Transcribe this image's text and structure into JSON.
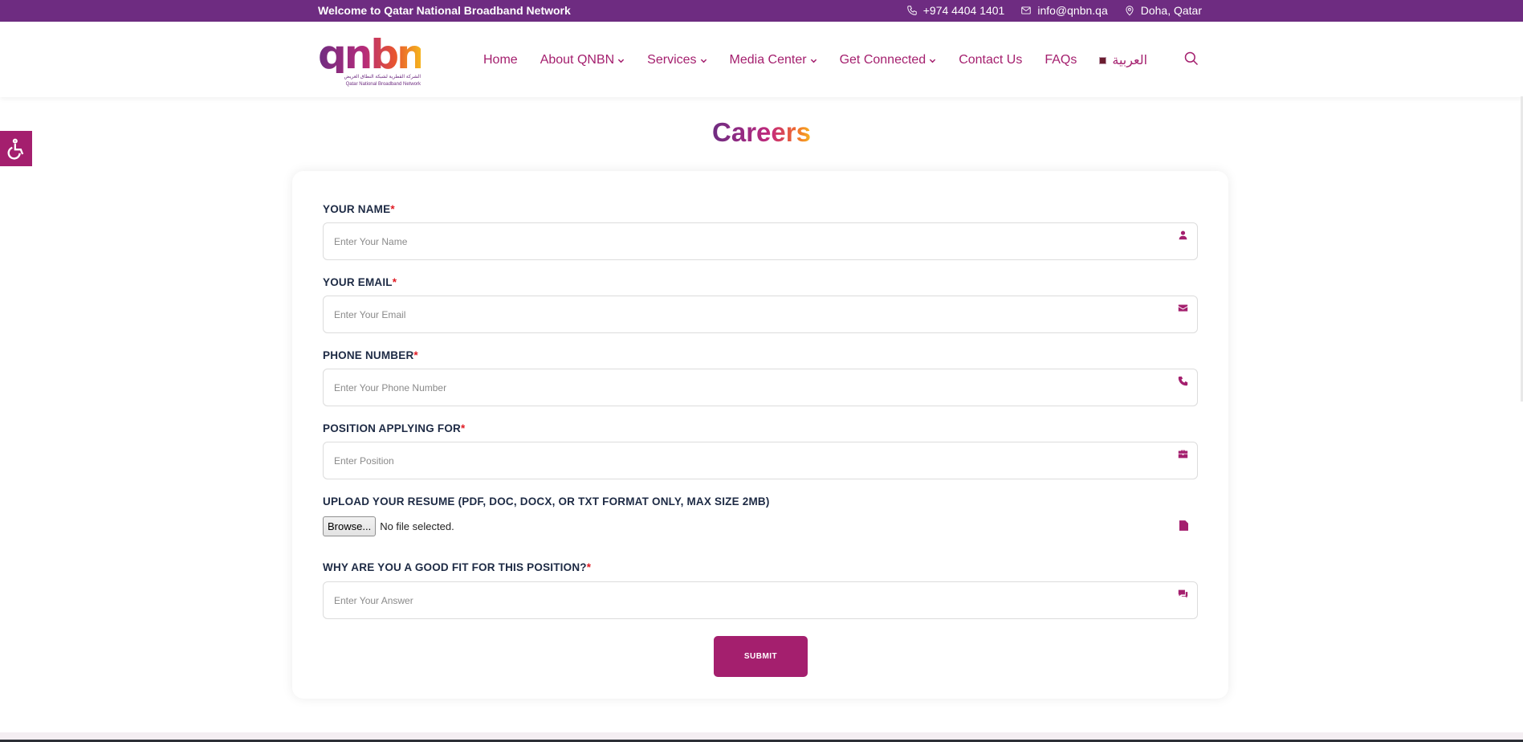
{
  "topbar": {
    "welcome": "Welcome to Qatar National Broadband Network",
    "phone": "+974 4404 1401",
    "email": "info@qnbn.qa",
    "location": "Doha, Qatar",
    "bg_color": "#6e2c81"
  },
  "logo": {
    "mark": "qnbn",
    "tagline_ar": "الشركة القطرية لشبكة النطاق العريض",
    "tagline_en": "Qatar National Broadband Network"
  },
  "nav": {
    "items": [
      {
        "label": "Home",
        "dropdown": false
      },
      {
        "label": "About QNBN",
        "dropdown": true
      },
      {
        "label": "Services",
        "dropdown": true
      },
      {
        "label": "Media Center",
        "dropdown": true
      },
      {
        "label": "Get Connected",
        "dropdown": true
      },
      {
        "label": "Contact Us",
        "dropdown": false
      },
      {
        "label": "FAQs",
        "dropdown": false
      }
    ],
    "language": "العربية",
    "accent_color": "#a41f6e"
  },
  "page": {
    "title": "Careers"
  },
  "form": {
    "name": {
      "label": "YOUR NAME",
      "required": "*",
      "placeholder": "Enter Your Name",
      "icon": "user-icon"
    },
    "email": {
      "label": "YOUR EMAIL",
      "required": "*",
      "placeholder": "Enter Your Email",
      "icon": "envelope-icon"
    },
    "phone": {
      "label": "PHONE NUMBER",
      "required": "*",
      "placeholder": "Enter Your Phone Number",
      "icon": "phone-icon"
    },
    "position": {
      "label": "POSITION APPLYING FOR",
      "required": "*",
      "placeholder": "Enter Position",
      "icon": "briefcase-icon"
    },
    "resume": {
      "label": "UPLOAD YOUR RESUME (PDF, DOC, DOCX, OR TXT FORMAT ONLY, MAX SIZE 2MB)",
      "browse_label": "Browse...",
      "status": "No file selected.",
      "icon": "file-icon"
    },
    "fit": {
      "label": "WHY ARE YOU A GOOD FIT FOR THIS POSITION?",
      "required": "*",
      "placeholder": "Enter Your Answer",
      "icon": "comments-icon"
    },
    "submit_label": "SUBMIT"
  }
}
